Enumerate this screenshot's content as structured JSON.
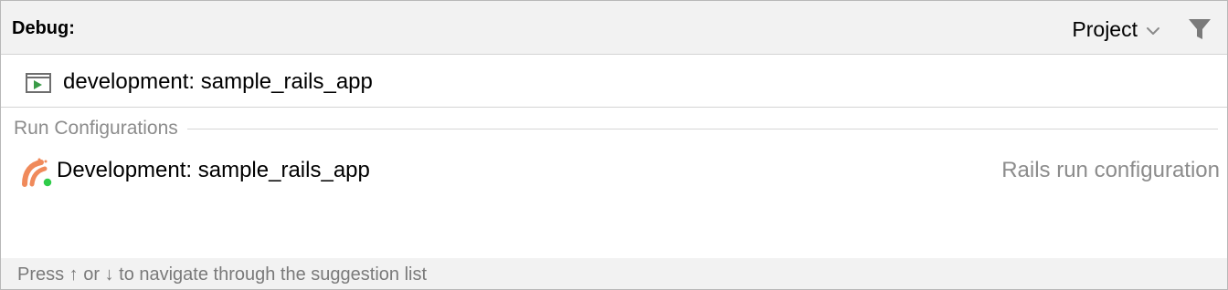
{
  "header": {
    "title": "Debug:",
    "scope_label": "Project",
    "scope_icon": "chevron-down-icon",
    "filter_icon": "filter-icon"
  },
  "search": {
    "icon": "run-configuration-icon",
    "value": "development: sample_rails_app"
  },
  "section": {
    "label": "Run Configurations"
  },
  "items": [
    {
      "icon": "rails-icon",
      "label": "Development: sample_rails_app",
      "type": "Rails run configuration"
    }
  ],
  "footer": {
    "hint": "Press ↑ or ↓ to navigate through the suggestion list"
  },
  "colors": {
    "header_bg": "#f2f2f2",
    "secondary_text": "#8c8c8c",
    "run_icon_green": "#3a9b47",
    "rails_orange": "#f08a5b",
    "status_green": "#2fcc4a"
  }
}
